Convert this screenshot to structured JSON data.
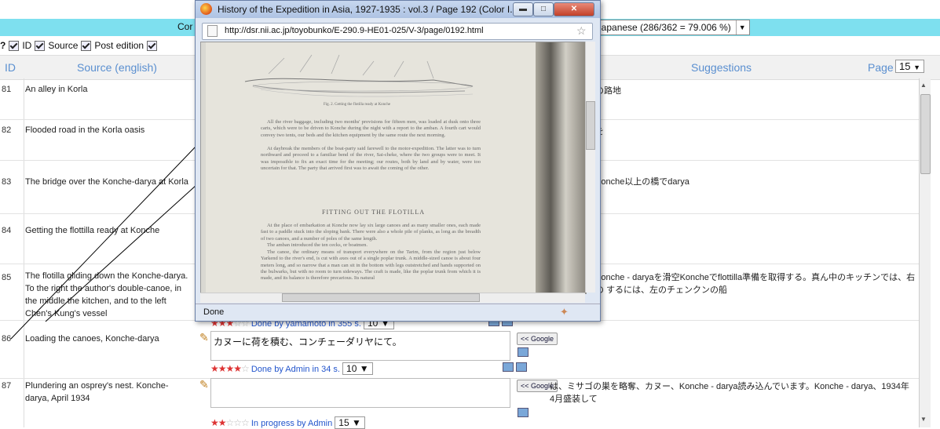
{
  "header": {
    "corp_label": "Cor",
    "language_select": "japanese (286/362 = 79.006 %)",
    "bg_color": "#7ee0ef"
  },
  "options": {
    "id_label": "ID",
    "source_label": "Source",
    "post_edition_label": "Post edition"
  },
  "columns": {
    "id": "ID",
    "source": "Source (english)",
    "suggestions": "Suggestions",
    "page_label": "Page",
    "page_value": "15"
  },
  "rows": [
    {
      "id": "81",
      "source": "An alley in Korla",
      "suggestion": "の路地"
    },
    {
      "id": "82",
      "source": "Flooded road in the Korla oasis",
      "suggestion": "を"
    },
    {
      "id": "83",
      "source": "The bridge over the Konche-darya at Korla",
      "suggestion": "Konche以上の橋でdarya"
    },
    {
      "id": "84",
      "source": "Getting the flottilla ready at Konche",
      "suggestion": ""
    },
    {
      "id": "85",
      "source": "The flotilla gliding down the Konche-darya. To the right the author's double-canoe, in the middle the kitchen, and to the left Chen's Kung's vessel",
      "suggestion": "Konche - daryaを滑空Koncheでflottilla準備を取得する。真ん中のキッチンでは、右の するには、左のチェンクンの船"
    },
    {
      "id": "86",
      "source": "Loading the canoes, Konche-darya",
      "translation": "カヌーに荷を積む、コンチェーダリヤにて。",
      "google": "<< Google"
    },
    {
      "id": "87",
      "source": "Plundering an osprey's nest. Konche-darya, April 1934",
      "google": "<< Google",
      "suggestion": "は、ミサゴの巣を略奪、カヌー、Konche - darya読み込んでいます。Konche - darya、1934年4月盛装して"
    }
  ],
  "status_86_prev": {
    "done": "Done by yamamoto in 355 s.",
    "score": "10"
  },
  "status_87_prev": {
    "done": "Done by Admin in 34 s.",
    "score": "10"
  },
  "status_88_prev": {
    "done": "In progress by Admin",
    "score": "15"
  },
  "popup": {
    "title": "History of the Expedition in Asia, 1927-1935 : vol.3 / Page 192 (Color I...",
    "url": "http://dsr.nii.ac.jp/toyobunko/E-290.9-HE01-025/V-3/page/0192.html",
    "status": "Done",
    "caption": "Fig. 2. Getting the flotilla ready at Konche",
    "heading": "FITTING OUT THE FLOTILLA",
    "para1": "All the river baggage, including two months' provisions for fifteen men, was loaded at dusk onto three carts, which were to be driven to Konche during the night with a report to the amban. A fourth cart would convey two tents, our beds and the kitchen equipment by the same route the next morning.",
    "para2": "At daybreak the members of the boat-party said farewell to the motor-expedition. The latter was to turn northward and proceed to a familiar bend of the river, Sai-cheke, where the two groups were to meet. It was impossible to fix an exact time for the meeting; our routes, both by land and by water, were too uncertain for that. The party that arrived first was to await the coming of the other.",
    "para3": "At the place of embarkation at Konche now lay six large canoes and as many smaller ones, each made fast to a paddle stuck into the sloping bank. There were also a whole pile of planks, as long as the breadth of two canoes, and a number of poles of the same length.",
    "para4": "The amban introduced the ten cecks, or boatmen.",
    "para5": "The canoe, the ordinary means of transport everywhere on the Tarim, from the region just below Yarkend to the river's end, is cut with axes out of a single poplar trunk. A middle-sized canoe is about four meters long, and so narrow that a man can sit in the bottom with legs outstretched and hands supported on the bulwarks, but with no room to turn sideways. The craft is made, like the poplar trunk from which it is made, and its balance is therefore precarious. Its natural"
  }
}
